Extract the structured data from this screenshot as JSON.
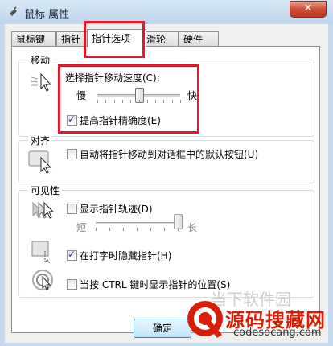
{
  "window": {
    "title": "鼠标 属性",
    "close_label": "✕"
  },
  "tabs": [
    {
      "label": "鼠标键"
    },
    {
      "label": "指针"
    },
    {
      "label": "指针选项"
    },
    {
      "label": "滑轮"
    },
    {
      "label": "硬件"
    }
  ],
  "motion": {
    "group_label": "移动",
    "speed_label": "选择指针移动速度(C):",
    "slow_label": "慢",
    "fast_label": "快",
    "speed_value": 0.5,
    "precision_label": "提高指针精确度(E)",
    "precision_checked": true
  },
  "snap": {
    "group_label": "对齐",
    "snap_label": "自动将指针移动到对话框中的默认按钮(U)",
    "snap_checked": false
  },
  "visibility": {
    "group_label": "可见性",
    "trails_label": "显示指针轨迹(D)",
    "trails_checked": false,
    "short_label": "短",
    "long_label": "长",
    "trails_value": 1.0,
    "hide_label": "在打字时隐藏指针(H)",
    "hide_checked": true,
    "ctrl_label": "当按 CTRL 键时显示指针的位置(S)",
    "ctrl_checked": false
  },
  "buttons": {
    "ok_label": "确定"
  },
  "watermark": {
    "brand_cn": "源码搜藏网",
    "domain": "codesocang.com",
    "faded_text": "当下软件园"
  },
  "colors": {
    "highlight_red": "#e0192a",
    "watermark_red": "#d81e06"
  }
}
